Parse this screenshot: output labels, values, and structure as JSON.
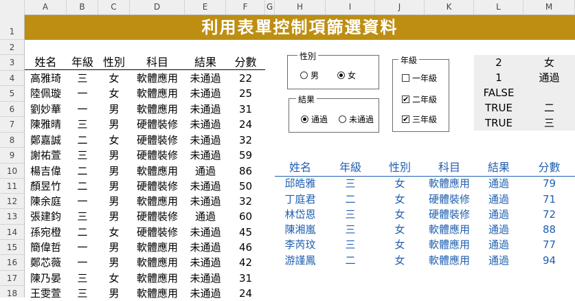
{
  "sheet": {
    "columns": [
      "A",
      "B",
      "C",
      "D",
      "E",
      "F",
      "G",
      "H",
      "I",
      "J",
      "K",
      "L",
      "M"
    ],
    "rows": [
      "1",
      "2",
      "3",
      "4",
      "5",
      "6",
      "7",
      "8",
      "9",
      "10",
      "11",
      "12",
      "13",
      "14",
      "15",
      "16",
      "17",
      "18"
    ],
    "title": "利用表單控制項篩選資料"
  },
  "table": {
    "headers": [
      "姓名",
      "年級",
      "性別",
      "科目",
      "結果",
      "分數"
    ],
    "rows": [
      [
        "高雅琦",
        "三",
        "女",
        "軟體應用",
        "未通過",
        "22"
      ],
      [
        "陸佩璇",
        "一",
        "女",
        "軟體應用",
        "未通過",
        "25"
      ],
      [
        "劉妙華",
        "一",
        "男",
        "軟體應用",
        "未通過",
        "31"
      ],
      [
        "陳雅晴",
        "三",
        "男",
        "硬體裝修",
        "未通過",
        "24"
      ],
      [
        "鄭嘉誠",
        "二",
        "女",
        "硬體裝修",
        "未通過",
        "32"
      ],
      [
        "謝祐萱",
        "三",
        "男",
        "硬體裝修",
        "未通過",
        "59"
      ],
      [
        "楊吉偉",
        "二",
        "男",
        "軟體應用",
        "通過",
        "86"
      ],
      [
        "顏昱竹",
        "二",
        "男",
        "硬體裝修",
        "未通過",
        "50"
      ],
      [
        "陳余庭",
        "一",
        "男",
        "軟體應用",
        "未通過",
        "32"
      ],
      [
        "張建鈞",
        "三",
        "男",
        "硬體裝修",
        "通過",
        "60"
      ],
      [
        "孫宛橙",
        "二",
        "女",
        "硬體裝修",
        "未通過",
        "45"
      ],
      [
        "簡偉哲",
        "一",
        "男",
        "軟體應用",
        "未通過",
        "46"
      ],
      [
        "鄭芯薇",
        "一",
        "男",
        "軟體應用",
        "未通過",
        "42"
      ],
      [
        "陳乃晏",
        "三",
        "女",
        "軟體應用",
        "未通過",
        "31"
      ],
      [
        "王雯萱",
        "三",
        "男",
        "軟體應用",
        "未通過",
        "24"
      ]
    ]
  },
  "controls": {
    "gender": {
      "label": "性別",
      "options": [
        "男",
        "女"
      ],
      "selected": "女"
    },
    "result": {
      "label": "結果",
      "options": [
        "通過",
        "未通過"
      ],
      "selected": "通過"
    },
    "grade": {
      "label": "年級",
      "options": [
        "一年級",
        "二年級",
        "三年級"
      ],
      "checked": [
        false,
        true,
        true
      ],
      "check_mark": "✔"
    }
  },
  "linked_cells": {
    "rows": [
      [
        "2",
        "女"
      ],
      [
        "1",
        "通過"
      ],
      [
        "FALSE",
        ""
      ],
      [
        "TRUE",
        "二"
      ],
      [
        "TRUE",
        "三"
      ]
    ]
  },
  "filtered": {
    "headers": [
      "姓名",
      "年級",
      "性別",
      "科目",
      "結果",
      "分數"
    ],
    "rows": [
      [
        "邱皓雅",
        "三",
        "女",
        "軟體應用",
        "通過",
        "79"
      ],
      [
        "丁庭君",
        "二",
        "女",
        "硬體裝修",
        "通過",
        "71"
      ],
      [
        "林岱恩",
        "三",
        "女",
        "硬體裝修",
        "通過",
        "72"
      ],
      [
        "陳湘嵐",
        "三",
        "女",
        "軟體應用",
        "通過",
        "88"
      ],
      [
        "李芮玟",
        "三",
        "女",
        "軟體應用",
        "通過",
        "77"
      ],
      [
        "游謹鳳",
        "二",
        "女",
        "軟體應用",
        "通過",
        "94"
      ]
    ]
  },
  "colors": {
    "title_band": "#bd8e12",
    "filtered_text": "#1f5fb0",
    "linked_bg": "#eeeeee"
  }
}
